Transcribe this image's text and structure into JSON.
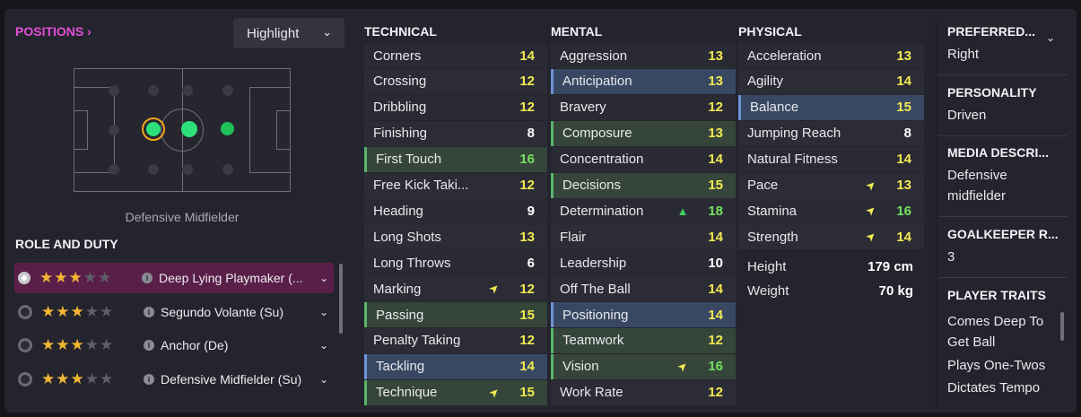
{
  "left": {
    "positions_link": "POSITIONS",
    "highlight_dropdown": "Highlight",
    "position_label": "Defensive Midfielder",
    "role_duty_title": "ROLE AND DUTY",
    "roles": [
      {
        "name": "Deep Lying Playmaker (...",
        "stars": 3,
        "selected": true
      },
      {
        "name": "Segundo Volante (Su)",
        "stars": 3,
        "selected": false
      },
      {
        "name": "Anchor (De)",
        "stars": 3,
        "selected": false
      },
      {
        "name": "Defensive Midfielder (Su)",
        "stars": 3,
        "selected": false
      }
    ]
  },
  "technical": {
    "title": "TECHNICAL",
    "attrs": [
      {
        "name": "Corners",
        "value": "14",
        "color": "yellow"
      },
      {
        "name": "Crossing",
        "value": "12",
        "color": "yellow"
      },
      {
        "name": "Dribbling",
        "value": "12",
        "color": "yellow"
      },
      {
        "name": "Finishing",
        "value": "8",
        "color": "white"
      },
      {
        "name": "First Touch",
        "value": "16",
        "color": "green",
        "highlight": "green"
      },
      {
        "name": "Free Kick Taki...",
        "value": "12",
        "color": "yellow"
      },
      {
        "name": "Heading",
        "value": "9",
        "color": "white"
      },
      {
        "name": "Long Shots",
        "value": "13",
        "color": "yellow"
      },
      {
        "name": "Long Throws",
        "value": "6",
        "color": "white"
      },
      {
        "name": "Marking",
        "value": "12",
        "color": "yellow",
        "trend": "up-yellow"
      },
      {
        "name": "Passing",
        "value": "15",
        "color": "yellow",
        "highlight": "green"
      },
      {
        "name": "Penalty Taking",
        "value": "12",
        "color": "yellow"
      },
      {
        "name": "Tackling",
        "value": "14",
        "color": "yellow",
        "highlight": "blue"
      },
      {
        "name": "Technique",
        "value": "15",
        "color": "yellow",
        "highlight": "green",
        "trend": "up-yellow"
      }
    ]
  },
  "mental": {
    "title": "MENTAL",
    "attrs": [
      {
        "name": "Aggression",
        "value": "13",
        "color": "yellow"
      },
      {
        "name": "Anticipation",
        "value": "13",
        "color": "yellow",
        "highlight": "blue"
      },
      {
        "name": "Bravery",
        "value": "12",
        "color": "yellow"
      },
      {
        "name": "Composure",
        "value": "13",
        "color": "yellow",
        "highlight": "green"
      },
      {
        "name": "Concentration",
        "value": "14",
        "color": "yellow"
      },
      {
        "name": "Decisions",
        "value": "15",
        "color": "yellow",
        "highlight": "green"
      },
      {
        "name": "Determination",
        "value": "18",
        "color": "green",
        "trend": "up-green"
      },
      {
        "name": "Flair",
        "value": "14",
        "color": "yellow"
      },
      {
        "name": "Leadership",
        "value": "10",
        "color": "white"
      },
      {
        "name": "Off The Ball",
        "value": "14",
        "color": "yellow"
      },
      {
        "name": "Positioning",
        "value": "14",
        "color": "yellow",
        "highlight": "blue"
      },
      {
        "name": "Teamwork",
        "value": "12",
        "color": "yellow",
        "highlight": "green"
      },
      {
        "name": "Vision",
        "value": "16",
        "color": "green",
        "highlight": "green",
        "trend": "up-yellow"
      },
      {
        "name": "Work Rate",
        "value": "12",
        "color": "yellow"
      }
    ]
  },
  "physical": {
    "title": "PHYSICAL",
    "attrs": [
      {
        "name": "Acceleration",
        "value": "13",
        "color": "yellow"
      },
      {
        "name": "Agility",
        "value": "14",
        "color": "yellow"
      },
      {
        "name": "Balance",
        "value": "15",
        "color": "yellow",
        "highlight": "blue"
      },
      {
        "name": "Jumping Reach",
        "value": "8",
        "color": "white"
      },
      {
        "name": "Natural Fitness",
        "value": "14",
        "color": "yellow"
      },
      {
        "name": "Pace",
        "value": "13",
        "color": "yellow",
        "trend": "up-yellow"
      },
      {
        "name": "Stamina",
        "value": "16",
        "color": "green",
        "trend": "up-yellow"
      },
      {
        "name": "Strength",
        "value": "14",
        "color": "yellow",
        "trend": "up-yellow"
      }
    ],
    "height_label": "Height",
    "height_value": "179 cm",
    "weight_label": "Weight",
    "weight_value": "70 kg"
  },
  "info": {
    "preferred_title": "PREFERRED...",
    "preferred_value": "Right",
    "personality_title": "PERSONALITY",
    "personality_value": "Driven",
    "media_title": "MEDIA DESCRI...",
    "media_value": "Defensive midfielder",
    "gk_title": "GOALKEEPER R...",
    "gk_value": "3",
    "traits_title": "PLAYER TRAITS",
    "traits": [
      "Comes Deep To Get Ball",
      "Plays One-Twos",
      "Dictates Tempo"
    ]
  },
  "colors": {
    "accent_pink": "#e24fd6",
    "value_yellow": "#f2ea52",
    "value_green": "#73e05e",
    "highlight_green": "#36453a",
    "highlight_blue": "#384863",
    "star": "#f2b633"
  }
}
